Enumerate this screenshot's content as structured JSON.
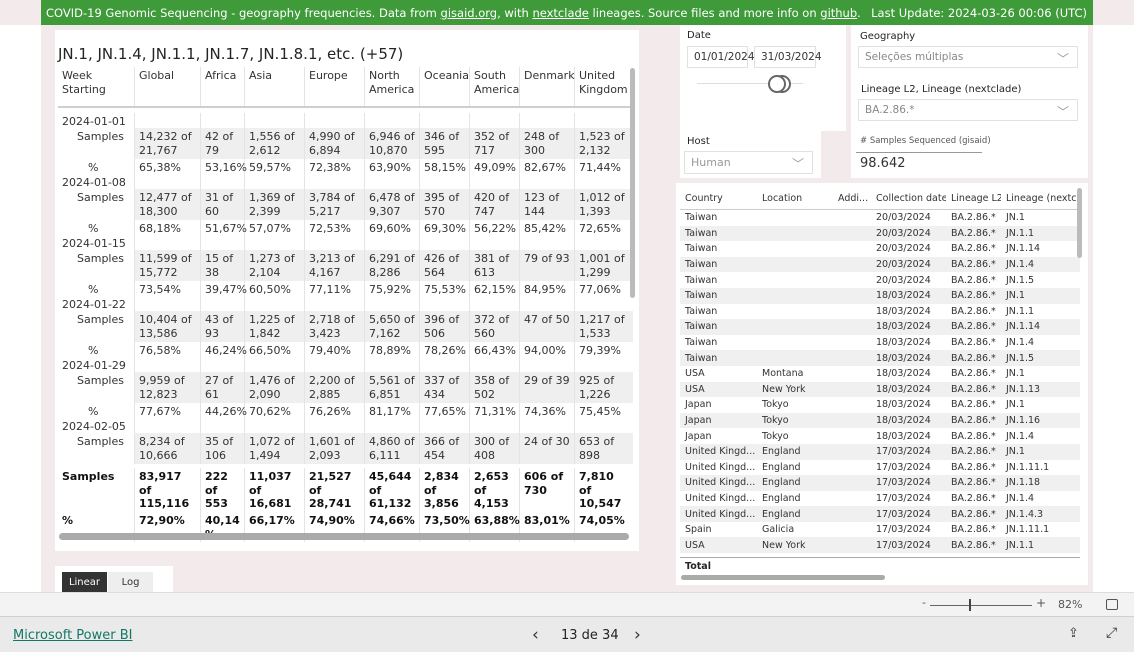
{
  "banner": {
    "prefix": "COVID-19 Genomic Sequencing - geography frequencies. Data from ",
    "link1": "gisaid.org",
    "mid": ", with ",
    "link2": "nextclade",
    "mid2": " lineages. Source files and more info on ",
    "link3": "github",
    "end": ".",
    "update": "Last Update: 2024-03-26 00:06 (UTC)"
  },
  "matrix": {
    "title": "JN.1, JN.1.4, JN.1.1, JN.1.7, JN.1.8.1, etc. (+57)",
    "headers": [
      "Week Starting",
      "Global",
      "Africa",
      "Asia",
      "Europe",
      "North America",
      "Oceania",
      "South America",
      "Denmark",
      "United Kingdom"
    ],
    "samples_label": "Samples",
    "pct_label": "%",
    "weeks": [
      {
        "date": "2024-01-01",
        "samples": [
          "14,232 of 21,767",
          "42 of 79",
          "1,556 of 2,612",
          "4,990 of 6,894",
          "6,946 of 10,870",
          "346 of 595",
          "352 of 717",
          "248 of 300",
          "1,523 of 2,132"
        ],
        "pct": [
          "65,38%",
          "53,16%",
          "59,57%",
          "72,38%",
          "63,90%",
          "58,15%",
          "49,09%",
          "82,67%",
          "71,44%"
        ]
      },
      {
        "date": "2024-01-08",
        "samples": [
          "12,477 of 18,300",
          "31 of 60",
          "1,369 of 2,399",
          "3,784 of 5,217",
          "6,478 of 9,307",
          "395 of 570",
          "420 of 747",
          "123 of 144",
          "1,012 of 1,393"
        ],
        "pct": [
          "68,18%",
          "51,67%",
          "57,07%",
          "72,53%",
          "69,60%",
          "69,30%",
          "56,22%",
          "85,42%",
          "72,65%"
        ]
      },
      {
        "date": "2024-01-15",
        "samples": [
          "11,599 of 15,772",
          "15 of 38",
          "1,273 of 2,104",
          "3,213 of 4,167",
          "6,291 of 8,286",
          "426 of 564",
          "381 of 613",
          "79 of 93",
          "1,001 of 1,299"
        ],
        "pct": [
          "73,54%",
          "39,47%",
          "60,50%",
          "77,11%",
          "75,92%",
          "75,53%",
          "62,15%",
          "84,95%",
          "77,06%"
        ]
      },
      {
        "date": "2024-01-22",
        "samples": [
          "10,404 of 13,586",
          "43 of 93",
          "1,225 of 1,842",
          "2,718 of 3,423",
          "5,650 of 7,162",
          "396 of 506",
          "372 of 560",
          "47 of 50",
          "1,217 of 1,533"
        ],
        "pct": [
          "76,58%",
          "46,24%",
          "66,50%",
          "79,40%",
          "78,89%",
          "78,26%",
          "66,43%",
          "94,00%",
          "79,39%"
        ]
      },
      {
        "date": "2024-01-29",
        "samples": [
          "9,959 of 12,823",
          "27 of 61",
          "1,476 of 2,090",
          "2,200 of 2,885",
          "5,561 of 6,851",
          "337 of 434",
          "358 of 502",
          "29 of 39",
          "925 of 1,226"
        ],
        "pct": [
          "77,67%",
          "44,26%",
          "70,62%",
          "76,26%",
          "81,17%",
          "77,65%",
          "71,31%",
          "74,36%",
          "75,45%"
        ]
      },
      {
        "date": "2024-02-05",
        "samples": [
          "8,234 of 10,666",
          "35 of 106",
          "1,072 of 1,494",
          "1,601 of 2,093",
          "4,860 of 6,111",
          "366 of 454",
          "300 of 408",
          "24 of 30",
          "653 of 898"
        ]
      }
    ],
    "totals": {
      "samples": [
        "83,917 of 115,116",
        "222 of 553",
        "11,037 of 16,681",
        "21,527 of 28,741",
        "45,644 of 61,132",
        "2,834 of 3,856",
        "2,653 of 4,153",
        "606 of 730",
        "7,810 of 10,547"
      ],
      "pct": [
        "72,90%",
        "40,14 %",
        "66,17%",
        "74,90%",
        "74,66%",
        "73,50%",
        "63,88%",
        "83,01%",
        "74,05%"
      ]
    }
  },
  "filters": {
    "date_label": "Date",
    "date_start": "01/01/2024",
    "date_end": "31/03/2024",
    "geography_label": "Geography",
    "geography_value": "Seleções múltiplas",
    "lineage_label": "Lineage L2, Lineage (nextclade)",
    "lineage_value": "BA.2.86.*",
    "host_label": "Host",
    "host_value": "Human",
    "samples_label": "# Samples Sequenced (gisaid)",
    "samples_value": "98.642"
  },
  "detail": {
    "headers": [
      "Country",
      "Location",
      "Addi...",
      "Collection date",
      "Lineage L2",
      "Lineage (nextcla"
    ],
    "rows": [
      [
        "Taiwan",
        "",
        "",
        "20/03/2024",
        "BA.2.86.*",
        "JN.1"
      ],
      [
        "Taiwan",
        "",
        "",
        "20/03/2024",
        "BA.2.86.*",
        "JN.1.1"
      ],
      [
        "Taiwan",
        "",
        "",
        "20/03/2024",
        "BA.2.86.*",
        "JN.1.14"
      ],
      [
        "Taiwan",
        "",
        "",
        "20/03/2024",
        "BA.2.86.*",
        "JN.1.4"
      ],
      [
        "Taiwan",
        "",
        "",
        "20/03/2024",
        "BA.2.86.*",
        "JN.1.5"
      ],
      [
        "Taiwan",
        "",
        "",
        "18/03/2024",
        "BA.2.86.*",
        "JN.1"
      ],
      [
        "Taiwan",
        "",
        "",
        "18/03/2024",
        "BA.2.86.*",
        "JN.1.1"
      ],
      [
        "Taiwan",
        "",
        "",
        "18/03/2024",
        "BA.2.86.*",
        "JN.1.14"
      ],
      [
        "Taiwan",
        "",
        "",
        "18/03/2024",
        "BA.2.86.*",
        "JN.1.4"
      ],
      [
        "Taiwan",
        "",
        "",
        "18/03/2024",
        "BA.2.86.*",
        "JN.1.5"
      ],
      [
        "USA",
        "Montana",
        "",
        "18/03/2024",
        "BA.2.86.*",
        "JN.1"
      ],
      [
        "USA",
        "New York",
        "",
        "18/03/2024",
        "BA.2.86.*",
        "JN.1.13"
      ],
      [
        "Japan",
        "Tokyo",
        "",
        "18/03/2024",
        "BA.2.86.*",
        "JN.1"
      ],
      [
        "Japan",
        "Tokyo",
        "",
        "18/03/2024",
        "BA.2.86.*",
        "JN.1.16"
      ],
      [
        "Japan",
        "Tokyo",
        "",
        "18/03/2024",
        "BA.2.86.*",
        "JN.1.4"
      ],
      [
        "United Kingd...",
        "England",
        "",
        "17/03/2024",
        "BA.2.86.*",
        "JN.1"
      ],
      [
        "United Kingd...",
        "England",
        "",
        "17/03/2024",
        "BA.2.86.*",
        "JN.1.11.1"
      ],
      [
        "United Kingd...",
        "England",
        "",
        "17/03/2024",
        "BA.2.86.*",
        "JN.1.18"
      ],
      [
        "United Kingd...",
        "England",
        "",
        "17/03/2024",
        "BA.2.86.*",
        "JN.1.4"
      ],
      [
        "United Kingd...",
        "England",
        "",
        "17/03/2024",
        "BA.2.86.*",
        "JN.1.4.3"
      ],
      [
        "Spain",
        "Galicia",
        "",
        "17/03/2024",
        "BA.2.86.*",
        "JN.1.11.1"
      ],
      [
        "USA",
        "New York",
        "",
        "17/03/2024",
        "BA.2.86.*",
        "JN.1.1"
      ]
    ],
    "total_label": "Total"
  },
  "scale": {
    "linear": "Linear",
    "log": "Log",
    "active": "Linear"
  },
  "footer": {
    "zoom_minus": "-",
    "zoom_plus": "+",
    "zoom": "82%",
    "zoom_level_percent": 82,
    "brand": "Microsoft Power BI",
    "page": "13 de 34",
    "prev": "‹",
    "next": "›"
  },
  "colors": {
    "banner": "#3f9a3a",
    "link": "#117865"
  }
}
